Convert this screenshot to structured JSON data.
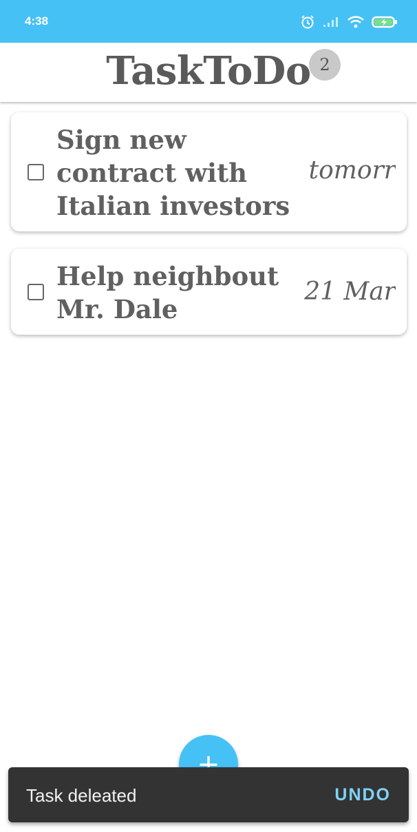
{
  "status_bar": {
    "time": "4:38",
    "icons": [
      "alarm-icon",
      "signal-icon",
      "wifi-icon",
      "battery-charging-icon"
    ],
    "background": "#46c1f5"
  },
  "header": {
    "title": "TaskToDo",
    "task_count": "2"
  },
  "tasks": [
    {
      "title": "Sign new contract with Italian investors",
      "date": "tomorr",
      "checked": false
    },
    {
      "title": "Help neighbout Mr. Dale",
      "date": "21 Mar",
      "checked": false
    }
  ],
  "fab": {
    "label": "+",
    "color": "#46c1f5"
  },
  "snackbar": {
    "message": "Task deleated",
    "action": "UNDO",
    "action_color": "#7fd3f7"
  }
}
